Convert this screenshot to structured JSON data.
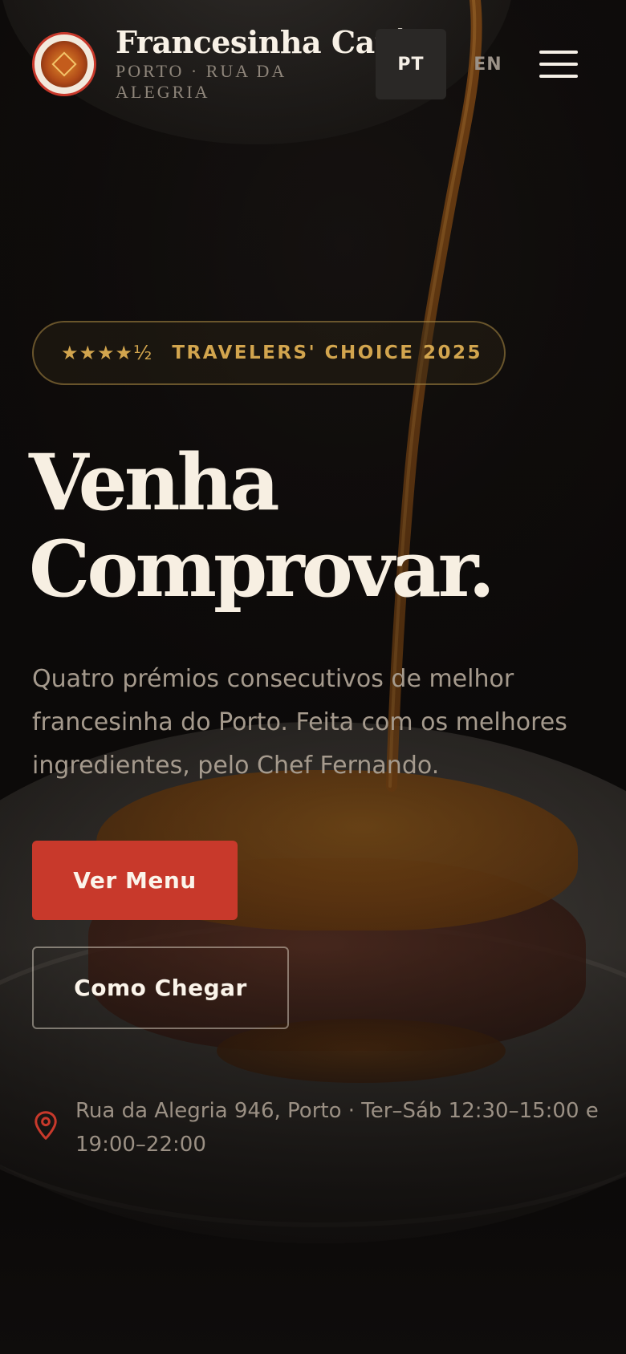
{
  "brand": {
    "name": "Francesinha Café",
    "subtitle": "PORTO · RUA DA ALEGRIA"
  },
  "header": {
    "lang_active": "PT",
    "lang_other": "EN",
    "menu_icon": "hamburger-icon"
  },
  "hero": {
    "badge_stars": "★★★★½",
    "badge_text": "TRAVELERS' CHOICE 2025",
    "headline_line1": "Venha",
    "headline_line2": "Comprovar.",
    "lede": "Quatro prémios consecutivos de melhor francesinha do Porto. Feita com os melhores ingredientes, pelo Chef Fernando.",
    "primary_cta": "Ver Menu",
    "secondary_cta": "Como Chegar",
    "info_icon": "map-pin-icon",
    "info_text": "Rua da Alegria 946, Porto · Ter–Sáb 12:30–15:00 e 19:00–22:00"
  },
  "colors": {
    "accent": "#c8392b",
    "gold": "#d2a54e",
    "background": "#0f0d0c",
    "text": "#f7efe2"
  }
}
